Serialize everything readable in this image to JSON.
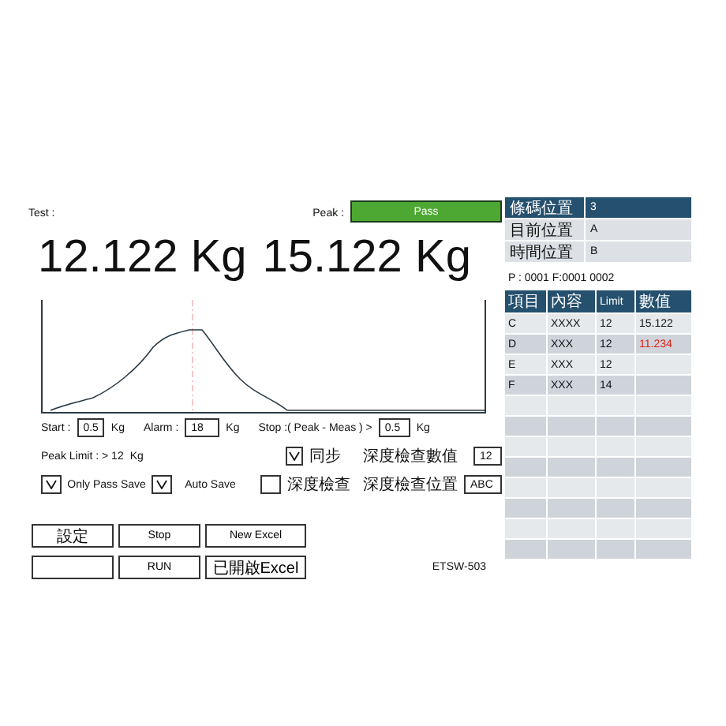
{
  "test_label": "Test :",
  "peak_label": "Peak :",
  "status": {
    "text": "Pass",
    "color": "#4ca832"
  },
  "readings": [
    "12.122 Kg",
    "15.122 Kg"
  ],
  "settings": {
    "start": {
      "label": "Start :",
      "value": "0.5",
      "unit": "Kg"
    },
    "alarm": {
      "label": "Alarm :",
      "value": "18",
      "unit": "Kg"
    },
    "stop": {
      "label": "Stop :( Peak - Meas ) >",
      "value": "0.5",
      "unit": "Kg"
    },
    "peak_limit": {
      "label": "Peak Limit : > 12",
      "unit": "Kg"
    },
    "sync": {
      "label": "同步",
      "checked": true
    },
    "depth_value": {
      "label": "深度檢查數值",
      "value": "12"
    },
    "only_pass_save": {
      "label": "Only Pass Save",
      "checked": true
    },
    "auto_save": {
      "label": "Auto Save",
      "checked": true
    },
    "depth_check": {
      "label": "深度檢查",
      "checked": false
    },
    "depth_position": {
      "label": "深度檢查位置",
      "value": "ABC"
    }
  },
  "buttons": [
    {
      "kind": "text",
      "label": "設定"
    },
    {
      "kind": "text",
      "label": "Stop"
    },
    {
      "kind": "text",
      "label": "New Excel"
    },
    {
      "kind": "blank"
    },
    {
      "kind": "text",
      "label": "RUN"
    },
    {
      "kind": "text",
      "label": "已開啟Excel"
    }
  ],
  "model": "ETSW-503",
  "info": [
    {
      "name": "條碼位置",
      "value": "3",
      "header": true
    },
    {
      "name": "目前位置",
      "value": "A",
      "header": false
    },
    {
      "name": "時間位置",
      "value": "B",
      "header": false
    }
  ],
  "counter": "P : 0001  F:0001    0002",
  "results": {
    "columns": [
      "項目",
      "內容",
      "Limit",
      "數值"
    ],
    "rows": [
      {
        "cells": [
          "C",
          "XXXX",
          "12",
          "15.122"
        ],
        "fail": false
      },
      {
        "cells": [
          "D",
          "XXX",
          "12",
          "11.234"
        ],
        "fail": true
      },
      {
        "cells": [
          "E",
          "XXX",
          "12"
        ]
      },
      {
        "cells": [
          "F",
          "XXX",
          "14"
        ]
      }
    ]
  }
}
